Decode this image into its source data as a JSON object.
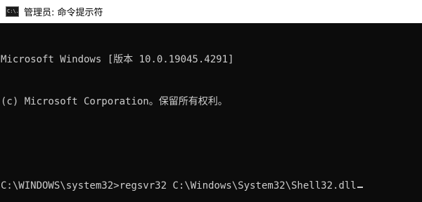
{
  "window": {
    "title": "管理员: 命令提示符",
    "icon": "cmd-icon",
    "icon_glyph": "C:\\."
  },
  "console": {
    "lines": [
      "Microsoft Windows [版本 10.0.19045.4291]",
      "(c) Microsoft Corporation。保留所有权利。",
      "",
      "C:\\WINDOWS\\system32>regsvr32 C:\\Windows\\System32\\Shell32.dll"
    ]
  }
}
